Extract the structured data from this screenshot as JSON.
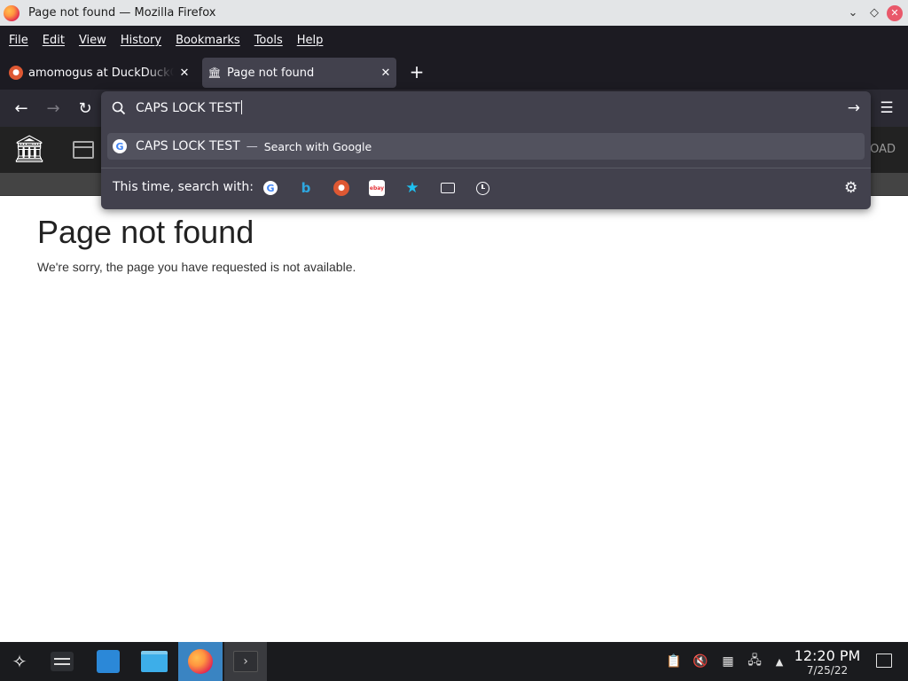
{
  "window": {
    "title": "Page not found — Mozilla Firefox",
    "controls": {
      "minimize_icon": "chevron-down-icon",
      "maximize_icon": "diamond-icon",
      "close_icon": "close-icon"
    }
  },
  "menubar": {
    "items": [
      {
        "label": "File"
      },
      {
        "label": "Edit"
      },
      {
        "label": "View"
      },
      {
        "label": "History"
      },
      {
        "label": "Bookmarks"
      },
      {
        "label": "Tools"
      },
      {
        "label": "Help"
      }
    ]
  },
  "tabs": [
    {
      "label": "amomogus at DuckDuckGo",
      "favicon": "duckduckgo-icon",
      "active": false
    },
    {
      "label": "Page not found",
      "favicon": "library-icon",
      "active": true
    }
  ],
  "urlbar": {
    "value": "CAPS LOCK TEST",
    "suggestion": {
      "text": "CAPS LOCK TEST",
      "separator": "—",
      "action": "Search with Google"
    },
    "search_with_label": "This time, search with:",
    "engines": [
      "google",
      "bing",
      "duckduckgo",
      "ebay",
      "bookmarks",
      "tabs",
      "history"
    ]
  },
  "site": {
    "header_right_text": "OAD"
  },
  "page": {
    "title": "Page not found",
    "description": "We're sorry, the page you have requested is not available."
  },
  "taskbar": {
    "time": "12:20 PM",
    "date": "7/25/22"
  },
  "colors": {
    "toolbar_dark": "#1c1b22",
    "navbar": "#2b2a33",
    "popup": "#42414d",
    "taskbar": "#1a1b1e",
    "active_task": "#3a84c2"
  }
}
